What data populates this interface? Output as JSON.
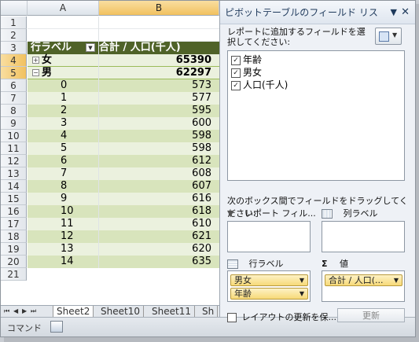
{
  "columns": {
    "a": "A",
    "b": "B"
  },
  "rows": [
    "1",
    "2",
    "3",
    "4",
    "5",
    "6",
    "7",
    "8",
    "9",
    "10",
    "11",
    "12",
    "13",
    "14",
    "15",
    "16",
    "17",
    "18",
    "19",
    "20",
    "21"
  ],
  "pivot": {
    "header_a": "行ラベル",
    "header_b": "合計 / 人口(千人)",
    "groups": [
      {
        "label": "女",
        "value": "65390",
        "expander": "+"
      },
      {
        "label": "男",
        "value": "62297",
        "expander": "−"
      }
    ],
    "items": [
      {
        "label": "0",
        "value": "573"
      },
      {
        "label": "1",
        "value": "577"
      },
      {
        "label": "2",
        "value": "595"
      },
      {
        "label": "3",
        "value": "600"
      },
      {
        "label": "4",
        "value": "598"
      },
      {
        "label": "5",
        "value": "598"
      },
      {
        "label": "6",
        "value": "612"
      },
      {
        "label": "7",
        "value": "608"
      },
      {
        "label": "8",
        "value": "607"
      },
      {
        "label": "9",
        "value": "616"
      },
      {
        "label": "10",
        "value": "618"
      },
      {
        "label": "11",
        "value": "610"
      },
      {
        "label": "12",
        "value": "621"
      },
      {
        "label": "13",
        "value": "620"
      },
      {
        "label": "14",
        "value": "635"
      }
    ]
  },
  "sheet_tabs": [
    "Sheet2",
    "Sheet10",
    "Sheet11",
    "Sh"
  ],
  "status": {
    "mode": "コマンド"
  },
  "pane": {
    "title": "ピボットテーブルのフィールド リス",
    "instruction": "レポートに追加するフィールドを選択してください:",
    "fields": [
      {
        "label": "年齢",
        "checked": true
      },
      {
        "label": "男女",
        "checked": true
      },
      {
        "label": "人口(千人)",
        "checked": true
      }
    ],
    "drag_instruction": "次のボックス間でフィールドをドラッグしてください:",
    "report_filter_label": "レポート フィル...",
    "column_labels_label": "列ラベル",
    "row_labels_label": "行ラベル",
    "values_label": "値",
    "row_fields": [
      "男女",
      "年齢"
    ],
    "value_fields": [
      "合計 / 人口(..."
    ],
    "defer_label": "レイアウトの更新を保...",
    "update_button": "更新"
  }
}
